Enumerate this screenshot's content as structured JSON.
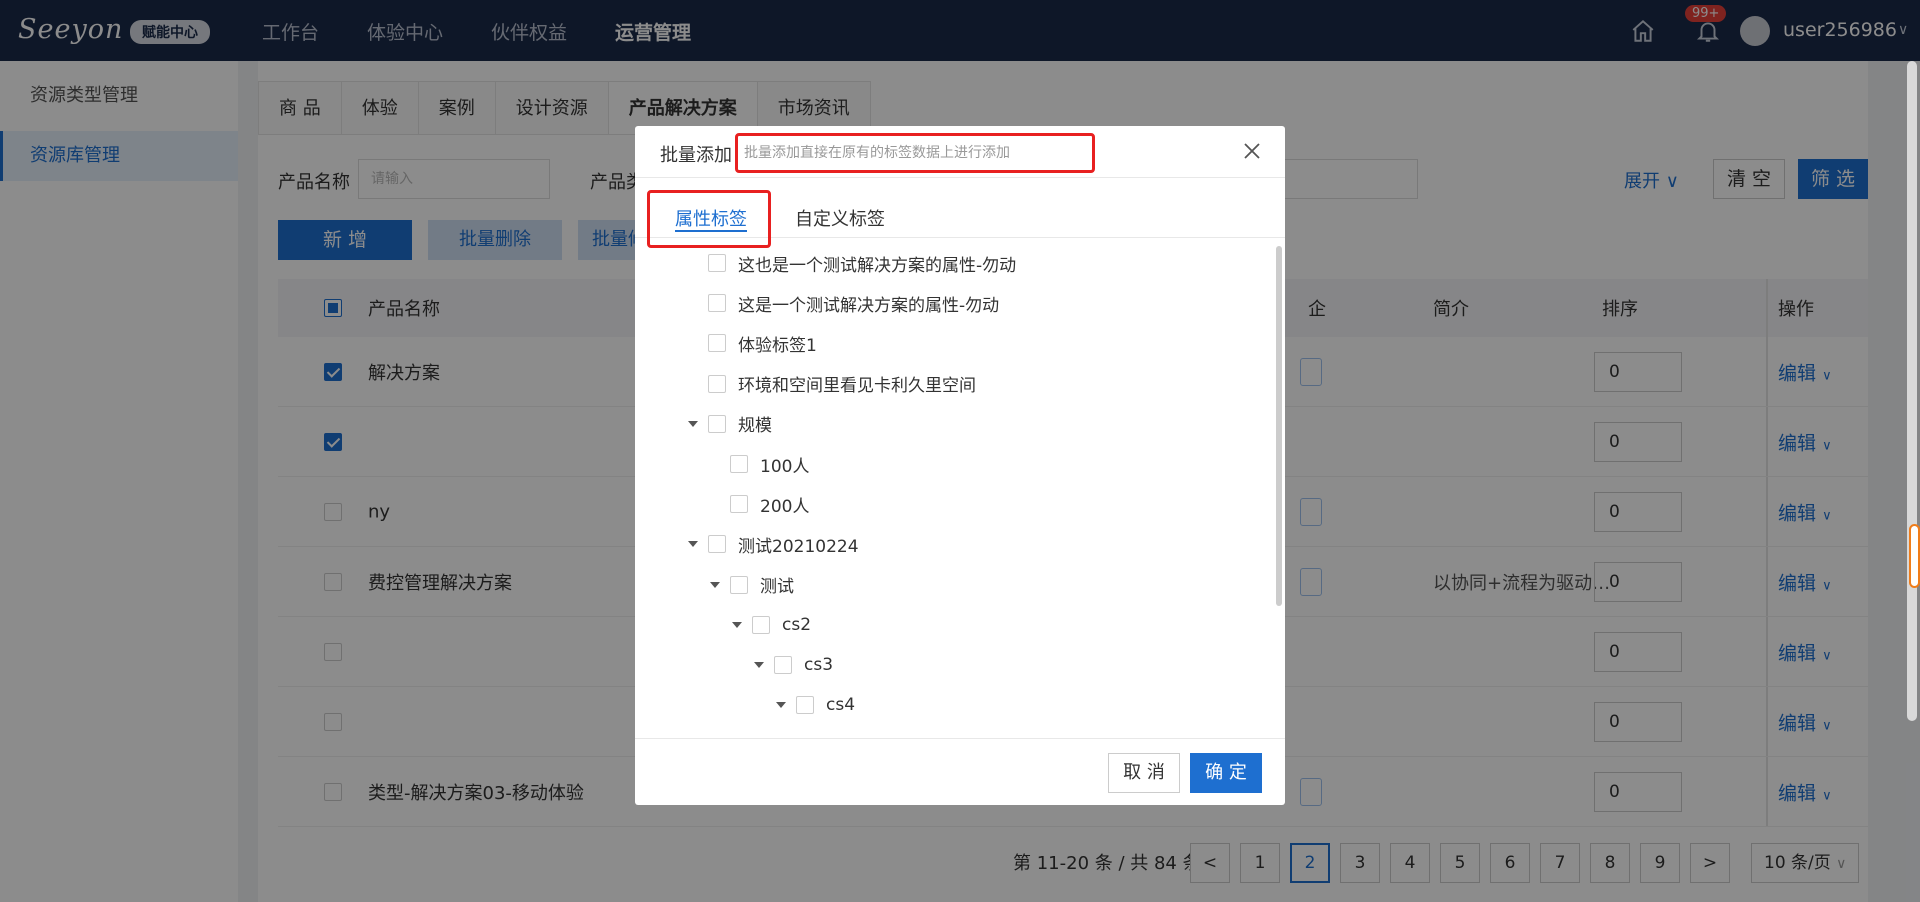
{
  "header": {
    "logo": "Seeyon",
    "logo_badge": "赋能中心",
    "nav": [
      "工作台",
      "体验中心",
      "伙伴权益",
      "运营管理"
    ],
    "notification_badge": "99+",
    "username": "user256986"
  },
  "sidebar": {
    "items": [
      {
        "label": "资源类型管理"
      },
      {
        "label": "资源库管理"
      }
    ]
  },
  "main": {
    "tabs": [
      "商 品",
      "体验",
      "案例",
      "设计资源",
      "产品解决方案",
      "市场资讯"
    ],
    "filters": {
      "name_label": "产品名称",
      "name_placeholder": "请输入",
      "type_label_partial": "产品类",
      "expand": "展开",
      "clear": "清 空",
      "filter": "筛 选"
    },
    "actions": {
      "add": "新 增",
      "bulk_delete": "批量删除",
      "bulk_other_partial": "批量修"
    },
    "table": {
      "headers": {
        "name": "产品名称",
        "enterprise_partial": "企",
        "intro": "简介",
        "sort": "排序",
        "ops": "操作"
      },
      "rows": [
        {
          "name": "解决方案",
          "intro": "",
          "sort": "0",
          "checked": true,
          "switch": true
        },
        {
          "name": "",
          "intro": "",
          "sort": "0",
          "checked": true,
          "switch": false
        },
        {
          "name": "ny",
          "intro": "",
          "sort": "0",
          "checked": false,
          "switch": true
        },
        {
          "name": "费控管理解决方案",
          "intro": "以协同+流程为驱动…",
          "sort": "0",
          "checked": false,
          "switch": true
        },
        {
          "name": "",
          "intro": "",
          "sort": "0",
          "checked": false,
          "switch": false
        },
        {
          "name": "",
          "intro": "",
          "sort": "0",
          "checked": false,
          "switch": false
        },
        {
          "name": "类型-解决方案03-移动体验",
          "intro": "",
          "sort": "0",
          "checked": false,
          "switch": true
        }
      ],
      "edit_label": "编辑"
    },
    "pagination": {
      "summary": "第 11-20 条 / 共 84 条",
      "pages": [
        "1",
        "2",
        "3",
        "4",
        "5",
        "6",
        "7",
        "8",
        "9"
      ],
      "current_page": "2",
      "prev": "<",
      "next": ">",
      "page_size": "10 条/页"
    }
  },
  "modal": {
    "title": "批量添加",
    "tip": "批量添加直接在原有的标签数据上进行添加",
    "tabs": [
      "属性标签",
      "自定义标签"
    ],
    "active_tab": "属性标签",
    "tree": [
      {
        "label": "这也是一个测试解决方案的属性-勿动",
        "level": 1,
        "expandable": false
      },
      {
        "label": "这是一个测试解决方案的属性-勿动",
        "level": 1,
        "expandable": false
      },
      {
        "label": "体验标签1",
        "level": 1,
        "expandable": false
      },
      {
        "label": "环境和空间里看见卡利久里空间",
        "level": 1,
        "expandable": false
      },
      {
        "label": "规模",
        "level": 1,
        "expandable": true
      },
      {
        "label": "100人",
        "level": 2,
        "expandable": false
      },
      {
        "label": "200人",
        "level": 2,
        "expandable": false
      },
      {
        "label": "测试20210224",
        "level": 1,
        "expandable": true
      },
      {
        "label": "测试",
        "level": 2,
        "expandable": true
      },
      {
        "label": "cs2",
        "level": 3,
        "expandable": true
      },
      {
        "label": "cs3",
        "level": 4,
        "expandable": true
      },
      {
        "label": "cs4",
        "level": 5,
        "expandable": true
      }
    ],
    "cancel": "取 消",
    "ok": "确 定"
  },
  "colors": {
    "primary": "#1e6fd0",
    "topbar": "#1b2a4a",
    "highlight_red": "#e82020",
    "badge_red": "#e8403a"
  }
}
